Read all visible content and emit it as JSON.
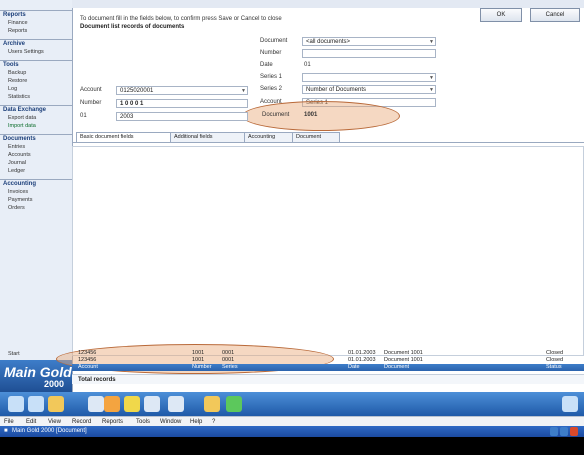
{
  "window": {
    "title": "Main Gold 2000 [Document]"
  },
  "menu": [
    "File",
    "Edit",
    "View",
    "Record",
    "Reports",
    "Tools",
    "Window",
    "Help",
    "?"
  ],
  "toolbar": {
    "labels": [
      "",
      "",
      "",
      "",
      "",
      "",
      "",
      "",
      ""
    ]
  },
  "sidebar": {
    "groups": [
      {
        "title": "Reports",
        "items": [
          "Finance",
          "Reports"
        ]
      },
      {
        "title": "Archive",
        "items": [
          "Users Settings"
        ]
      },
      {
        "title": "Tools",
        "items": [
          "Backup",
          "Restore",
          "Log",
          "Statistics"
        ]
      },
      {
        "title": "Data Exchange",
        "items": [
          "Export data",
          "Import data"
        ]
      },
      {
        "title": "Documents",
        "items": [
          "Entries",
          "Accounts",
          "Journal",
          "Ledger"
        ]
      },
      {
        "title": "Accounting",
        "items": [
          "Invoices",
          "Payments",
          "Orders"
        ]
      }
    ],
    "bottom_label": "Start",
    "logo_main": "Main Gold",
    "logo_sub": "2000"
  },
  "form": {
    "heading": "To document fill in the fields below, to confirm press Save or Cancel to close",
    "heading2": "Document list records of documents",
    "ok_label": "OK",
    "cancel_label": "Cancel",
    "right": [
      {
        "label": "Document",
        "value": "<all documents>"
      },
      {
        "label": "Number",
        "value": ""
      },
      {
        "label": "Date",
        "value": "01"
      },
      {
        "label": "Series 1",
        "value": ""
      },
      {
        "label": "Series 2",
        "value": "Number of Documents"
      },
      {
        "label": "Account",
        "value": "Series 1"
      },
      {
        "label": "Document",
        "value": "1001"
      }
    ],
    "left": [
      {
        "label": "Account",
        "value": "0125020001"
      },
      {
        "label": "Number",
        "value": "1 0 0 0 1"
      },
      {
        "label": "01",
        "value": "2003"
      }
    ],
    "tabs": [
      "Basic document fields",
      "Additional fields",
      "Accounting",
      "Document"
    ]
  },
  "grid": {
    "rows": [
      {
        "c1": "123456",
        "c2": "1001",
        "c3": "0001",
        "c4": "01.01.2003",
        "c5": "Document 1001",
        "c6": "Closed"
      },
      {
        "c1": "123456",
        "c2": "1001",
        "c3": "0001",
        "c4": "01.01.2003",
        "c5": "Document 1001",
        "c6": "Closed"
      }
    ],
    "header": [
      "Account",
      "Number",
      "Series",
      "Date",
      "Document",
      "Status"
    ],
    "status": "Total records"
  }
}
